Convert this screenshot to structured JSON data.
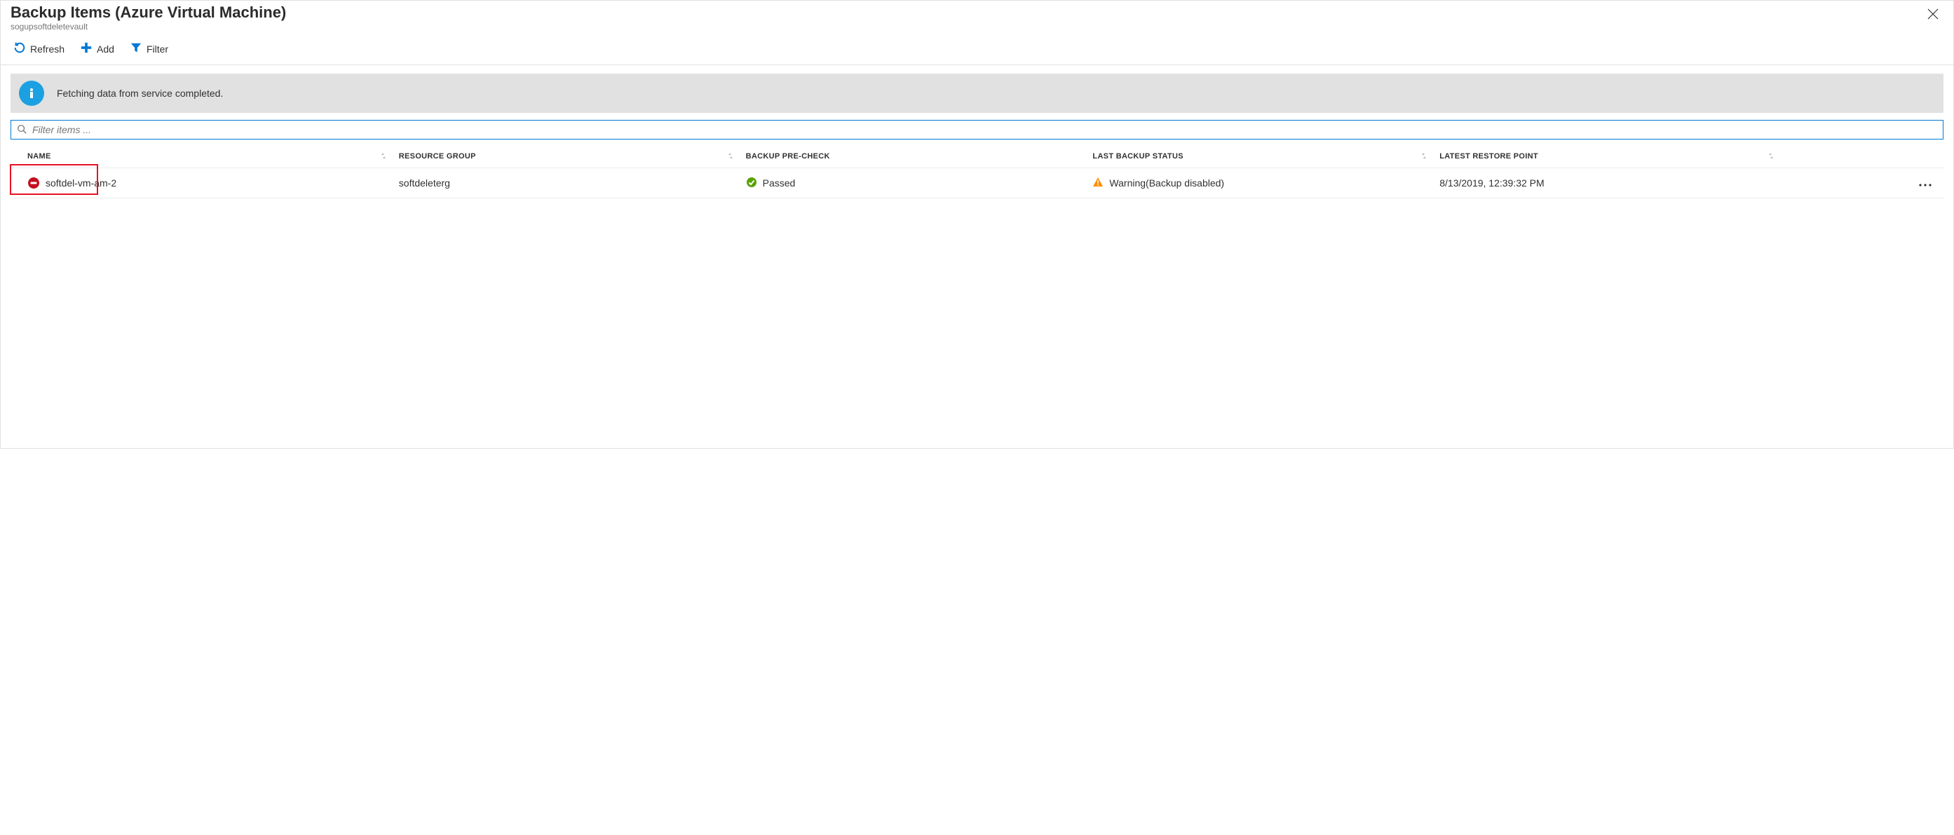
{
  "header": {
    "title": "Backup Items (Azure Virtual Machine)",
    "subtitle": "sogupsoftdeletevault"
  },
  "toolbar": {
    "refresh": "Refresh",
    "add": "Add",
    "filter": "Filter"
  },
  "info": {
    "message": "Fetching data from service completed."
  },
  "search": {
    "placeholder": "Filter items ..."
  },
  "columns": {
    "name": "Name",
    "resource_group": "Resource Group",
    "backup_precheck": "Backup Pre-Check",
    "last_backup_status": "Last Backup Status",
    "latest_restore_point": "Latest Restore Point"
  },
  "rows": [
    {
      "name": "softdel-vm-am-2",
      "resource_group": "softdeleterg",
      "precheck_label": "Passed",
      "last_backup_status": "Warning(Backup disabled)",
      "latest_restore_point": "8/13/2019, 12:39:32 PM"
    }
  ]
}
